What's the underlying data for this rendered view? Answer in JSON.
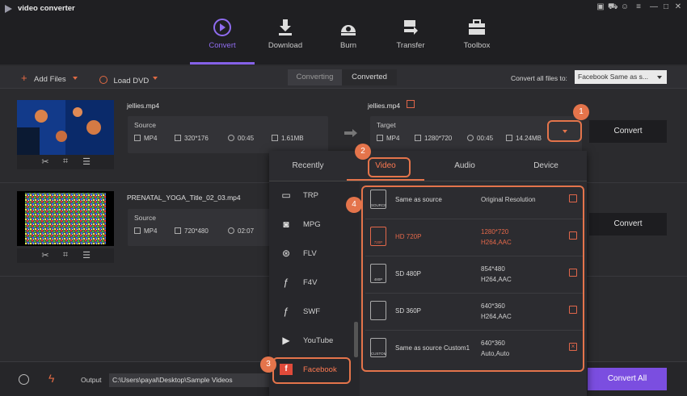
{
  "app": {
    "title": "video converter"
  },
  "nav": {
    "tabs": [
      {
        "label": "Convert"
      },
      {
        "label": "Download"
      },
      {
        "label": "Burn"
      },
      {
        "label": "Transfer"
      },
      {
        "label": "Toolbox"
      }
    ]
  },
  "toolbar": {
    "add_files": "Add Files",
    "load_dvd": "Load DVD",
    "seg_converting": "Converting",
    "seg_converted": "Converted",
    "convert_all_label": "Convert all files to:",
    "convert_all_value": "Facebook Same as s..."
  },
  "files": [
    {
      "name": "jellies.mp4",
      "source_label": "Source",
      "format": "MP4",
      "resolution": "320*176",
      "duration": "00:45",
      "size": "1.61MB",
      "target_name": "jellies.mp4",
      "target_label": "Target",
      "target_format": "MP4",
      "target_resolution": "1280*720",
      "target_duration": "00:45",
      "target_size": "14.24MB",
      "convert": "Convert"
    },
    {
      "name": "PRENATAL_YOGA_Title_02_03.mp4",
      "source_label": "Source",
      "format": "MP4",
      "resolution": "720*480",
      "duration": "02:07",
      "convert": "Convert"
    }
  ],
  "dropdown": {
    "tabs": [
      "Recently",
      "Video",
      "Audio",
      "Device"
    ],
    "formats": [
      "TRP",
      "MPG",
      "FLV",
      "F4V",
      "SWF",
      "YouTube",
      "Facebook"
    ],
    "presets": [
      {
        "name": "Same as source",
        "r1": "Original Resolution",
        "r2": "",
        "icon": "SOURCE"
      },
      {
        "name": "HD 720P",
        "r1": "1280*720",
        "r2": "H264,AAC",
        "icon": "720P"
      },
      {
        "name": "SD 480P",
        "r1": "854*480",
        "r2": "H264,AAC",
        "icon": "480P"
      },
      {
        "name": "SD 360P",
        "r1": "640*360",
        "r2": "H264,AAC",
        "icon": ""
      },
      {
        "name": "Same as source Custom1",
        "r1": "640*360",
        "r2": "Auto,Auto",
        "icon": "CUSTOM"
      }
    ]
  },
  "callouts": [
    "1",
    "2",
    "3",
    "4"
  ],
  "bottom": {
    "output_label": "Output",
    "output_path": "C:\\Users\\payal\\Desktop\\Sample Videos",
    "convert_all": "Convert All"
  },
  "colors": {
    "accent": "#8561e8",
    "orange": "#e4744b"
  }
}
